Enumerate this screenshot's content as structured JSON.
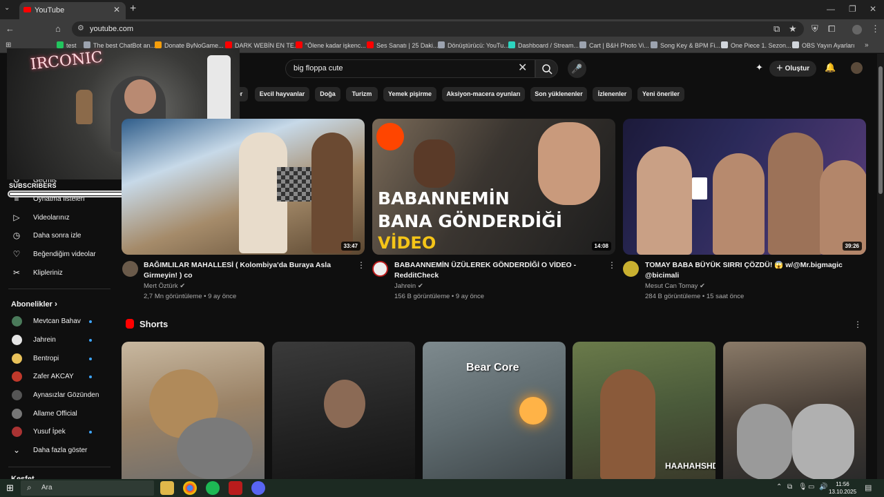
{
  "browser": {
    "tab_title": "YouTube",
    "url": "youtube.com",
    "bookmarks": [
      {
        "label": "test",
        "color": "#22c55e"
      },
      {
        "label": "The best ChatBot an...",
        "color": "#9ca3af"
      },
      {
        "label": "Donate ByNoGame...",
        "color": "#f59e0b"
      },
      {
        "label": "DARK WEBİN EN TE...",
        "color": "#ff0000"
      },
      {
        "label": "\"Ölene kadar işkenc...",
        "color": "#ff0000"
      },
      {
        "label": "Ses Sanatı | 25 Daki...",
        "color": "#ff0000"
      },
      {
        "label": "Dönüştürücü: YouTu...",
        "color": "#9ca3af"
      },
      {
        "label": "Dashboard / Stream...",
        "color": "#2dd4bf"
      },
      {
        "label": "Cart | B&H Photo Vi...",
        "color": "#9ca3af"
      },
      {
        "label": "Song Key & BPM Fi...",
        "color": "#9ca3af"
      },
      {
        "label": "One Piece 1. Sezon...",
        "color": "#d1d5db"
      },
      {
        "label": "OBS Yayın Ayarları",
        "color": "#d1d5db"
      }
    ]
  },
  "header": {
    "search_query": "big floppa cute",
    "create_label": "Oluştur"
  },
  "chips": [
    "er",
    "Evcil hayvanlar",
    "Doğa",
    "Turizm",
    "Yemek pişirme",
    "Aksiyon-macera oyunları",
    "Son yüklenenler",
    "İzlenenler",
    "Yeni öneriler"
  ],
  "sidebar": {
    "items": [
      {
        "label": "Geçmiş",
        "icon": "history-icon",
        "glyph": "↺"
      },
      {
        "label": "Oynatma listeleri",
        "icon": "playlist-icon",
        "glyph": "≡"
      },
      {
        "label": "Videolarınız",
        "icon": "your-videos-icon",
        "glyph": "▷"
      },
      {
        "label": "Daha sonra izle",
        "icon": "watch-later-icon",
        "glyph": "◷"
      },
      {
        "label": "Beğendiğim videolar",
        "icon": "thumbs-up-icon",
        "glyph": "👍"
      },
      {
        "label": "Klipleriniz",
        "icon": "scissors-icon",
        "glyph": "✂"
      }
    ],
    "subscriptions_title": "Abonelikler",
    "subscriptions": [
      {
        "label": "Mevtcan Bahav",
        "color": "#4a7a5a"
      },
      {
        "label": "Jahrein",
        "color": "#e5e5e5"
      },
      {
        "label": "Bentropi",
        "color": "#e8c15a"
      },
      {
        "label": "Zafer AKCAY",
        "color": "#c0392b"
      },
      {
        "label": "Aynasızlar Gözünden",
        "color": "#555555"
      },
      {
        "label": "Allame Official",
        "color": "#777777"
      },
      {
        "label": "Yusuf İpek",
        "color": "#aa3333"
      }
    ],
    "show_more": "Daha fazla göster",
    "explore_title": "Keşfet"
  },
  "overlay": {
    "neon": "IRCONIC",
    "subscribers_label": "SUBSCRIBERS",
    "subscribers_progress": 0.5
  },
  "videos": [
    {
      "title": "BAĞIMLILAR MAHALLESİ ( Kolombiya'da Buraya Asla Girmeyin! ) co",
      "channel": "Mert Öztürk",
      "meta": "2,7 Mn görüntüleme • 9 ay önce",
      "duration": "33:47",
      "thumb_text": ""
    },
    {
      "title": "BABAANNEMİN ÜZÜLEREK GÖNDERDİĞİ O VİDEO - RedditCheck",
      "channel": "Jahrein",
      "meta": "156 B görüntüleme • 9 ay önce",
      "duration": "14:08",
      "thumb_text_1": "BABANNEMİN",
      "thumb_text_2": "BANA GÖNDERDİĞİ",
      "thumb_text_3": "VİDEO"
    },
    {
      "title": "TOMAY BABA BÜYÜK SIRRI ÇÖZDÜ! 😱 w/@Mr.bigmagic @bicimali",
      "channel": "Mesut Can Tomay",
      "meta": "284 B görüntüleme • 15 saat önce",
      "duration": "39:26"
    }
  ],
  "shorts": {
    "title": "Shorts",
    "items": [
      {
        "overlay": ""
      },
      {
        "overlay": ""
      },
      {
        "overlay": "Bear Core"
      },
      {
        "overlay": "HAAHAHSHDHDHDH"
      },
      {
        "overlay": ""
      }
    ]
  },
  "taskbar": {
    "search_label": "Ara",
    "time": "11:56",
    "date": "13.10.2025"
  }
}
